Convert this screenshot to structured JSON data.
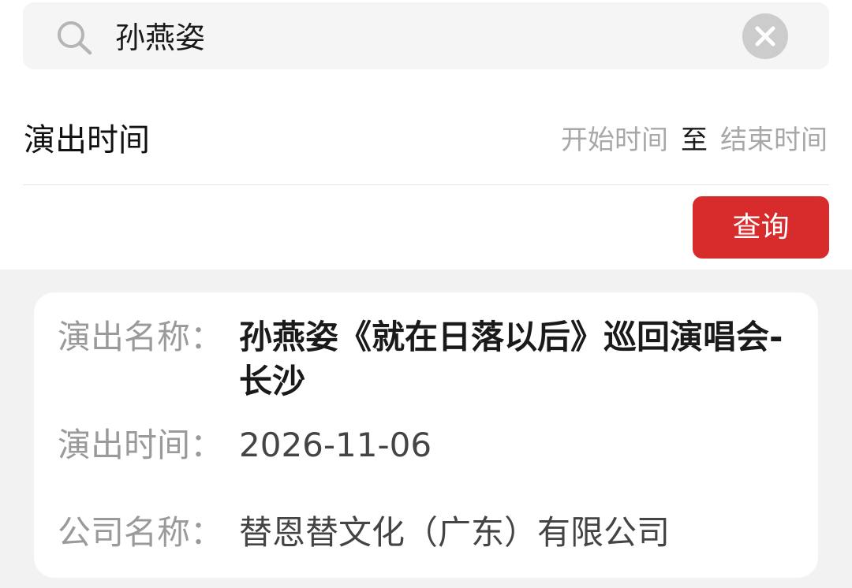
{
  "search": {
    "value": "孙燕姿",
    "icons": {
      "search": "search-icon",
      "clear": "clear-icon"
    }
  },
  "filter": {
    "date_label": "演出时间",
    "start_placeholder": "开始时间",
    "separator": "至",
    "end_placeholder": "结束时间",
    "query_label": "查询"
  },
  "colors": {
    "accent": "#d82b2b",
    "page_bg": "#f2f2f2",
    "label_gray": "#9a9a9a"
  },
  "result": {
    "name_label": "演出名称：",
    "name_value": "孙燕姿《就在日落以后》巡回演唱会-长沙",
    "time_label": "演出时间：",
    "time_value": "2026-11-06",
    "company_label": "公司名称：",
    "company_value": "替恩替文化（广东）有限公司"
  }
}
